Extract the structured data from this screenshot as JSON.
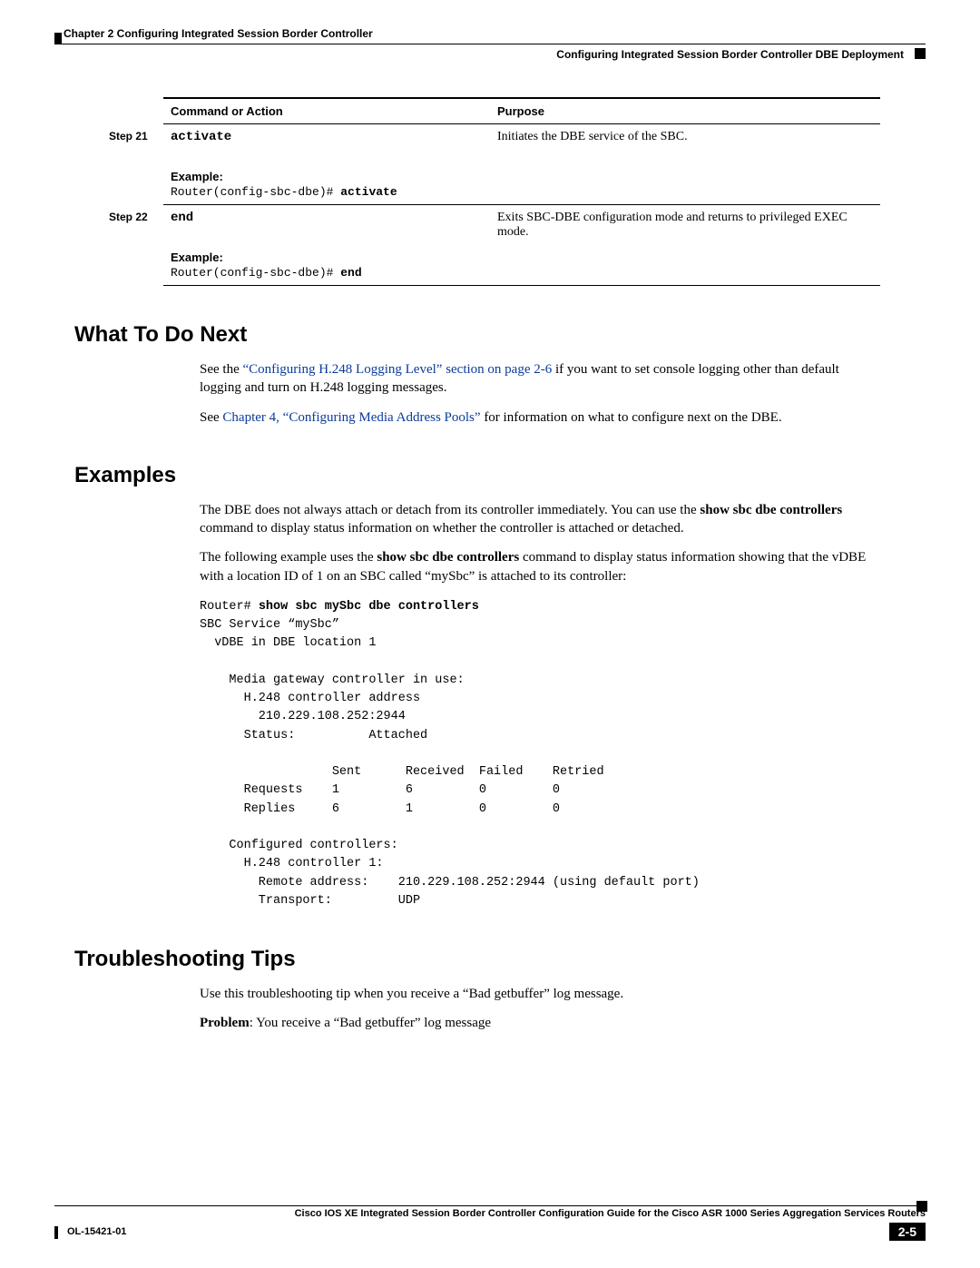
{
  "runhead": {
    "chapter": "Chapter 2      Configuring Integrated Session Border Controller",
    "section": "Configuring Integrated Session Border Controller DBE Deployment"
  },
  "table": {
    "header_cmd": "Command or Action",
    "header_purpose": "Purpose",
    "rows": [
      {
        "step": "Step 21",
        "command": "activate",
        "example_label": "Example:",
        "example_prompt": "Router(config-sbc-dbe)# ",
        "example_bold": "activate",
        "purpose": "Initiates the DBE service of the SBC."
      },
      {
        "step": "Step 22",
        "command": "end",
        "example_label": "Example:",
        "example_prompt": "Router(config-sbc-dbe)# ",
        "example_bold": "end",
        "purpose": "Exits SBC-DBE configuration mode and returns to privileged EXEC mode."
      }
    ]
  },
  "sections": {
    "what_next": {
      "heading": "What To Do Next",
      "p1_pre": "See the ",
      "p1_link": "“Configuring H.248 Logging Level” section on page 2-6",
      "p1_post": " if you want to set console logging other than default logging and turn on H.248 logging messages.",
      "p2_pre": "See ",
      "p2_link": "Chapter 4, “Configuring Media Address Pools”",
      "p2_post": " for information on what to configure next on the DBE."
    },
    "examples": {
      "heading": "Examples",
      "p1_a": "The DBE does not always attach or detach from its controller immediately. You can use the ",
      "p1_b": "show sbc dbe controllers",
      "p1_c": " command to display status information on whether the controller is attached or detached.",
      "p2_a": "The following example uses the ",
      "p2_b": "show sbc dbe controllers",
      "p2_c": " command to display status information showing that the vDBE with a location ID of 1 on an SBC called “mySbc” is attached to its controller:",
      "code_prompt": "Router# ",
      "code_cmd": "show sbc mySbc dbe controllers",
      "code_body": "\nSBC Service “mySbc”\n  vDBE in DBE location 1\n\n    Media gateway controller in use:\n      H.248 controller address\n        210.229.108.252:2944\n      Status:          Attached\n\n                  Sent      Received  Failed    Retried\n      Requests    1         6         0         0\n      Replies     6         1         0         0\n\n    Configured controllers:\n      H.248 controller 1:\n        Remote address:    210.229.108.252:2944 (using default port)\n        Transport:         UDP"
    },
    "troubleshooting": {
      "heading": "Troubleshooting Tips",
      "p1": "Use this troubleshooting tip when you receive a “Bad getbuffer” log message.",
      "p2_label": "Problem",
      "p2_rest": ": You receive a “Bad getbuffer” log message"
    }
  },
  "footer": {
    "book_title": "Cisco IOS XE Integrated Session Border Controller Configuration Guide for the Cisco ASR 1000 Series Aggregation Services Routers",
    "doc_id": "OL-15421-01",
    "page": "2-5"
  }
}
